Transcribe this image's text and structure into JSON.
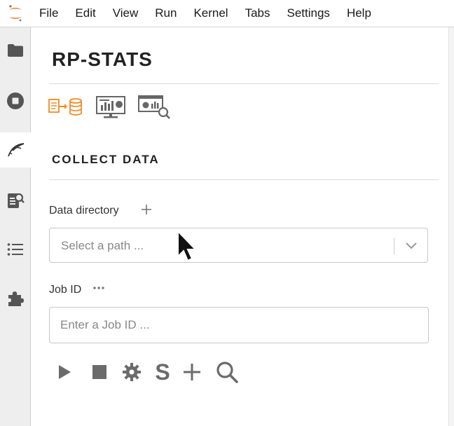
{
  "menubar": {
    "items": [
      "File",
      "Edit",
      "View",
      "Run",
      "Kernel",
      "Tabs",
      "Settings",
      "Help"
    ]
  },
  "sidebar": {
    "items": [
      {
        "icon": "folder-icon"
      },
      {
        "icon": "stop-circle-icon"
      },
      {
        "icon": "feather-icon",
        "active": true
      },
      {
        "icon": "clipboard-search-icon"
      },
      {
        "icon": "list-icon"
      },
      {
        "icon": "puzzle-icon"
      }
    ]
  },
  "panel": {
    "title": "RP-STATS",
    "toolbar": [
      "collect-data-icon",
      "dashboard-monitor-icon",
      "analysis-search-icon"
    ],
    "section_title": "COLLECT DATA",
    "data_directory": {
      "label": "Data directory",
      "placeholder": "Select a path ..."
    },
    "job_id": {
      "label": "Job ID",
      "placeholder": "Enter a Job ID ..."
    },
    "actions": [
      "play-icon",
      "stop-icon",
      "gear-icon",
      "s-icon",
      "plus-icon",
      "search-icon"
    ]
  },
  "colors": {
    "accent_orange": "#f08a24",
    "icon_gray": "#666666",
    "sidebar_bg": "#eeeeee"
  }
}
